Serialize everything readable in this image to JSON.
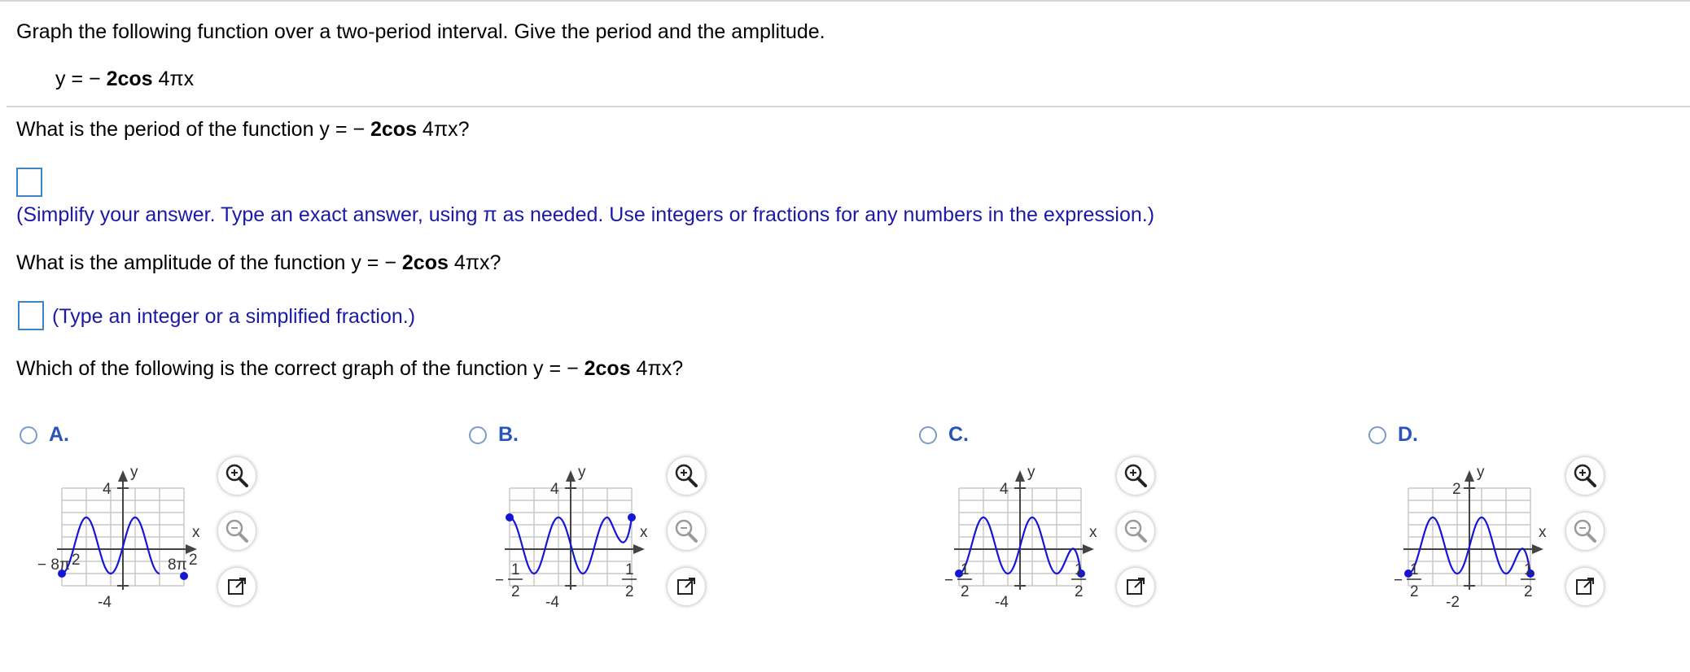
{
  "question": {
    "intro": "Graph the following function over a two-period interval. Give the period and the amplitude.",
    "equation_lhs": "y = ",
    "equation_minus": "−",
    "equation_coef": "2cos",
    "equation_arg": " 4πx",
    "period_prompt": "What is the period of the function y = ",
    "period_prompt_end": "?",
    "period_hint": "(Simplify your answer. Type an exact answer, using π as needed. Use integers or fractions for any numbers in the expression.)",
    "amplitude_prompt": "What is the amplitude of the function y = ",
    "amplitude_prompt_end": "?",
    "amplitude_hint": "(Type an integer or a simplified fraction.)",
    "graph_prompt": "Which of the following is the correct graph of the function y = ",
    "graph_prompt_end": "?"
  },
  "answers": {
    "period_value": "",
    "amplitude_value": ""
  },
  "options": [
    {
      "label": "A.",
      "y_axis_label": "y",
      "x_axis_label": "x",
      "y_top_tick": "4",
      "y_bottom_tick": "-4",
      "x_left_tick": "− 8π",
      "x_right_tick": "8π",
      "endpoint_value_left": "2",
      "endpoint_value_right": "2",
      "chart_data": {
        "type": "line",
        "function": "y = 2cos(4πx)",
        "curve": "cosine, 2 periods",
        "start": "minimum",
        "ylim": [
          -4,
          4
        ]
      }
    },
    {
      "label": "B.",
      "y_axis_label": "y",
      "x_axis_label": "x",
      "y_top_tick": "4",
      "y_bottom_tick": "-4",
      "x_left_minus": "−",
      "x_left_num": "1",
      "x_left_den": "2",
      "x_right_num": "1",
      "x_right_den": "2",
      "chart_data": {
        "type": "line",
        "curve": "cosine, 2 periods",
        "start": "maximum",
        "xlim": [
          -0.5,
          0.5
        ],
        "ylim": [
          -4,
          4
        ]
      }
    },
    {
      "label": "C.",
      "y_axis_label": "y",
      "x_axis_label": "x",
      "y_top_tick": "4",
      "y_bottom_tick": "-4",
      "x_left_minus": "−",
      "x_left_num": "1",
      "x_left_den": "2",
      "x_right_num": "1",
      "x_right_den": "2",
      "chart_data": {
        "type": "line",
        "curve": "cosine, 2 periods",
        "start": "minimum",
        "xlim": [
          -0.5,
          0.5
        ],
        "ylim": [
          -4,
          4
        ]
      }
    },
    {
      "label": "D.",
      "y_axis_label": "y",
      "x_axis_label": "x",
      "y_top_tick": "2",
      "y_bottom_tick": "-2",
      "x_left_minus": "−",
      "x_left_num": "1",
      "x_left_den": "2",
      "x_right_num": "1",
      "x_right_den": "2",
      "chart_data": {
        "type": "line",
        "curve": "cosine, 2 periods",
        "start": "minimum",
        "xlim": [
          -0.5,
          0.5
        ],
        "ylim": [
          -2,
          2
        ]
      }
    }
  ],
  "tools": {
    "zoom_in_icon": "magnifier-plus",
    "zoom_out_icon": "magnifier-minus",
    "popout_icon": "external-window"
  },
  "colors": {
    "curve": "#1515d6",
    "hint": "#1a1aa6",
    "option_label": "#2a55b8",
    "answer_box": "#3b86c9"
  }
}
